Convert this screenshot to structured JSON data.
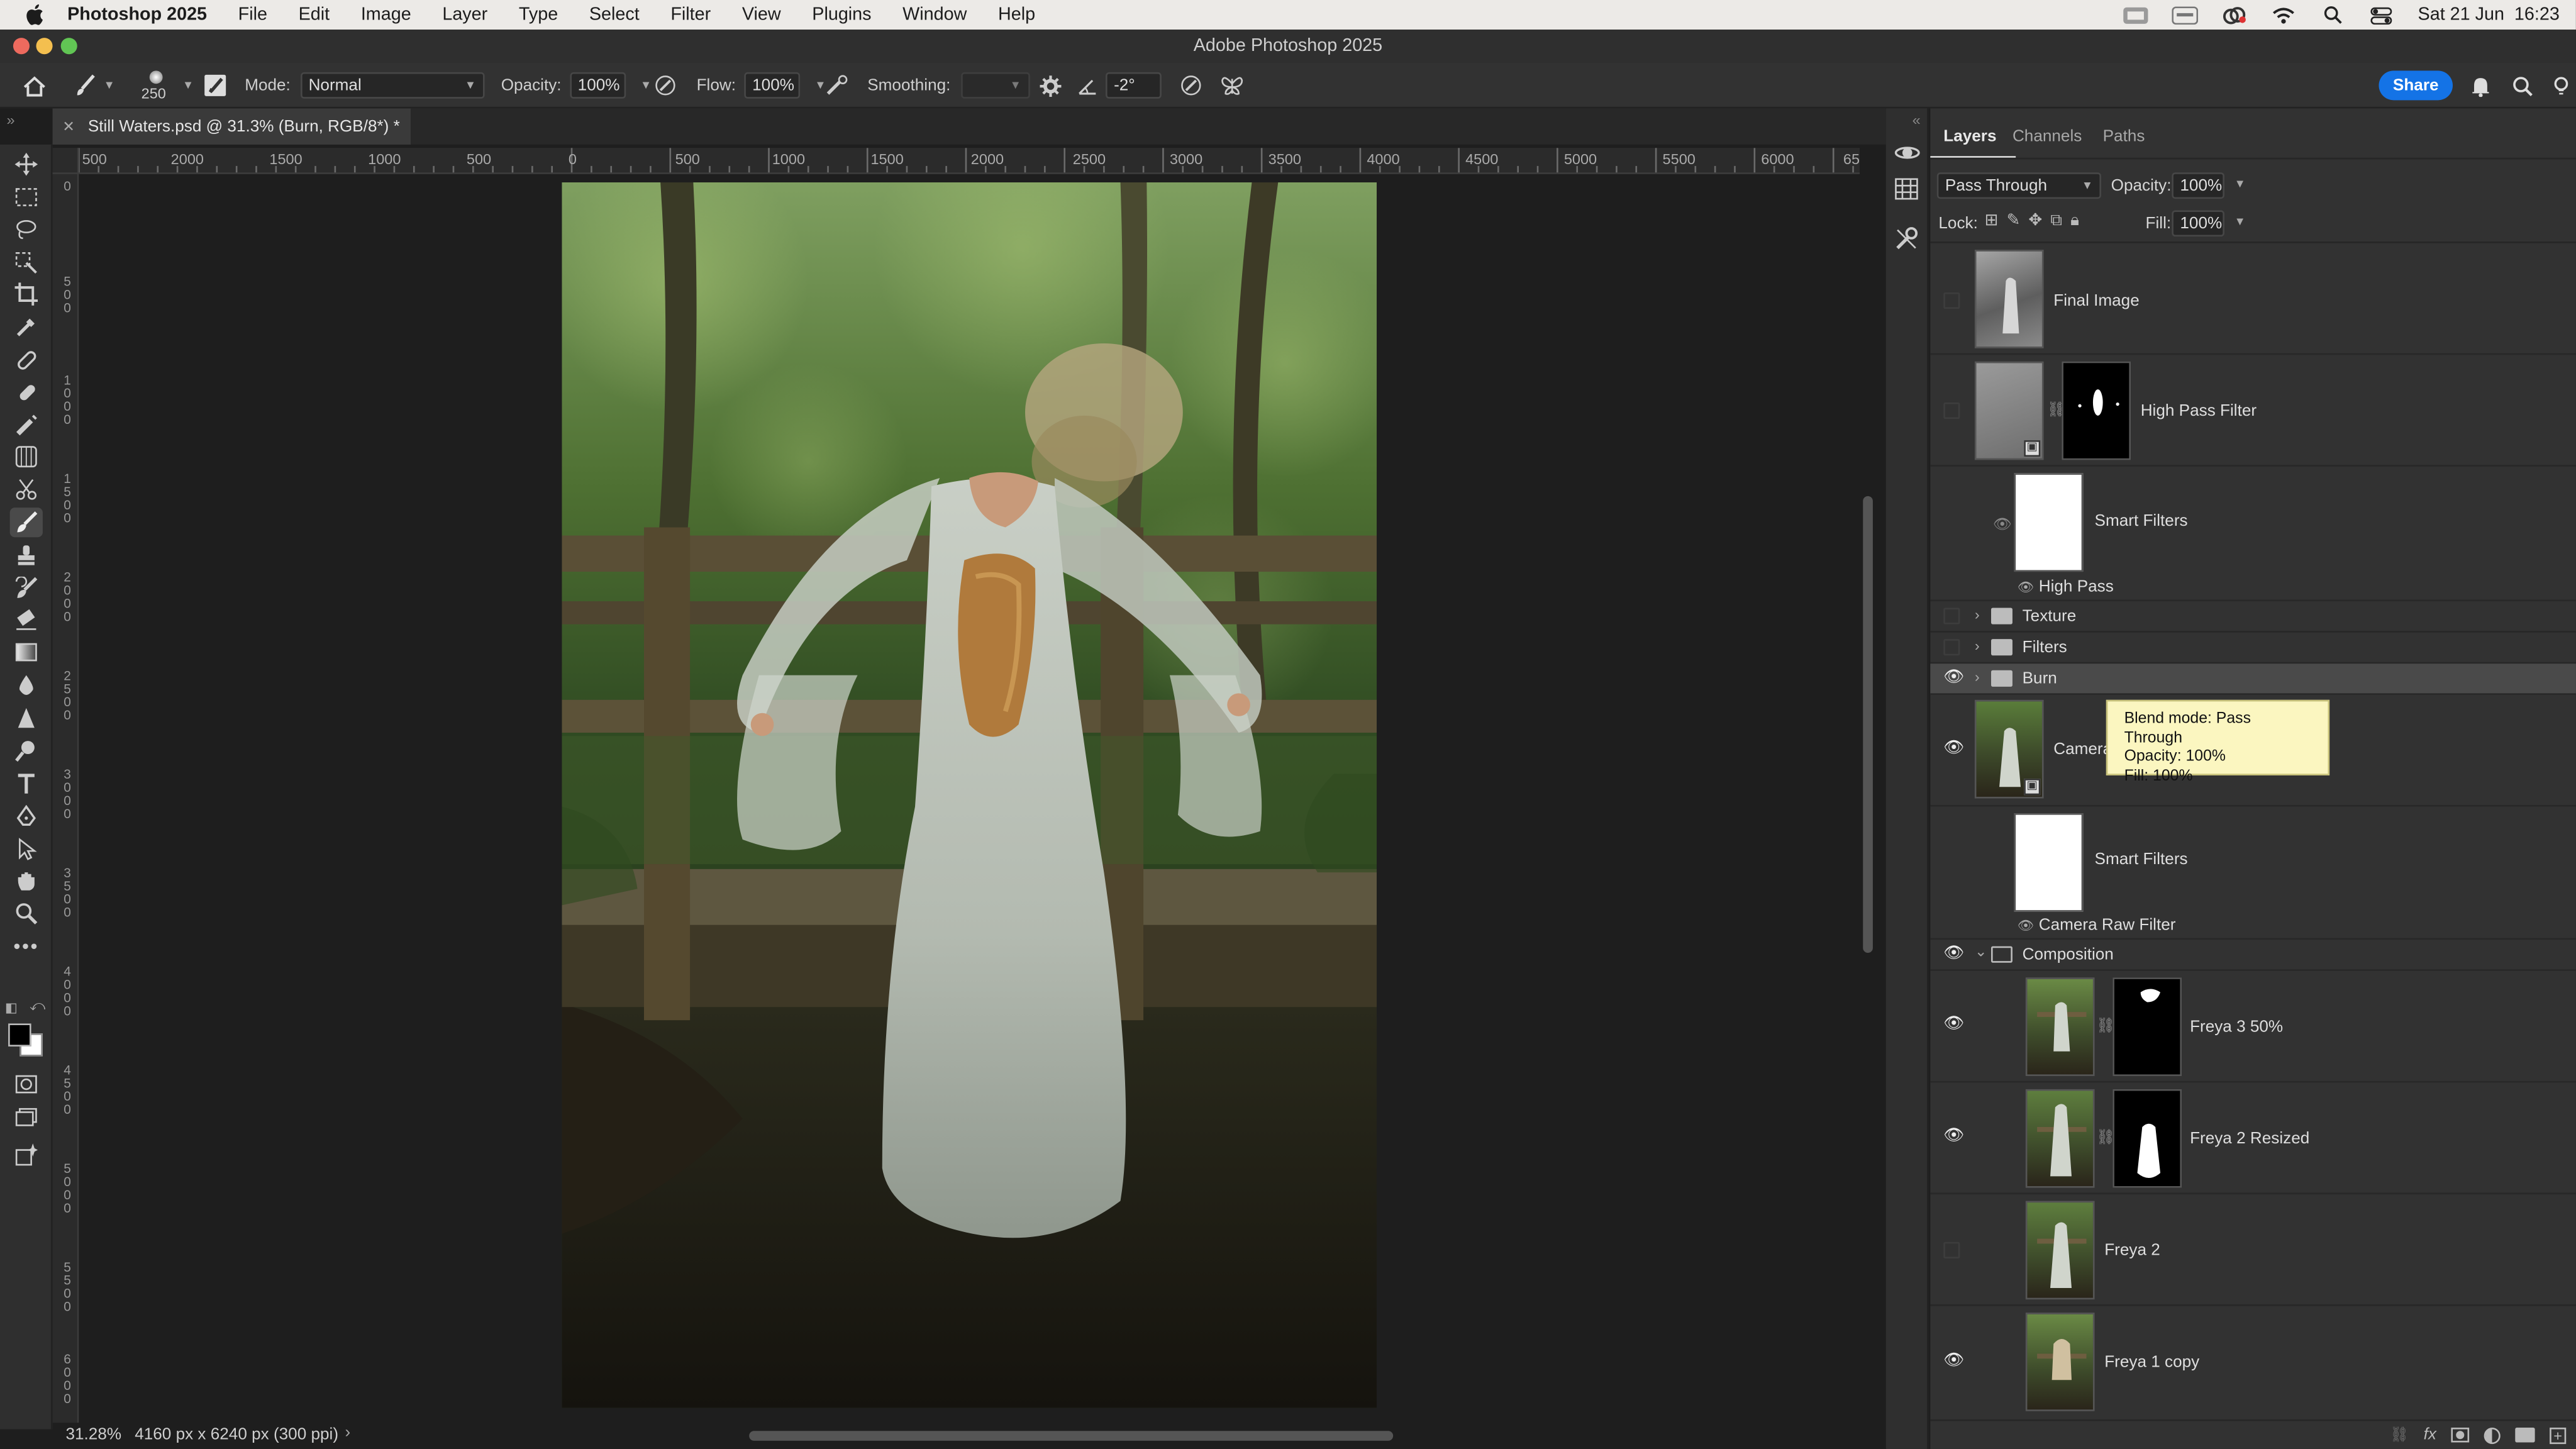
{
  "menubar": {
    "app": "Photoshop 2025",
    "items": [
      "File",
      "Edit",
      "Image",
      "Layer",
      "Type",
      "Select",
      "Filter",
      "View",
      "Plugins",
      "Window",
      "Help"
    ],
    "clock": "Sat 21 Jun  16:23"
  },
  "window": {
    "title": "Adobe Photoshop 2025"
  },
  "options": {
    "brush_size": "250",
    "mode_label": "Mode:",
    "mode_value": "Normal",
    "opacity_label": "Opacity:",
    "opacity_value": "100%",
    "flow_label": "Flow:",
    "flow_value": "100%",
    "smoothing_label": "Smoothing:",
    "smoothing_value": "",
    "angle_value": "-2°",
    "share_label": "Share"
  },
  "document": {
    "tab_title": "Still Waters.psd @ 31.3% (Burn, RGB/8*) *",
    "zoom": "31.28%",
    "info": "4160 px x 6240 px (300 ppi)"
  },
  "ruler_h": [
    "500",
    "2000",
    "1500",
    "1000",
    "500",
    "0",
    "500",
    "1000",
    "1500",
    "2000",
    "2500",
    "3000",
    "3500",
    "4000",
    "4500",
    "5000",
    "5500",
    "6000",
    "65"
  ],
  "ruler_v": [
    "0",
    "500",
    "1000",
    "1500",
    "2000",
    "2500",
    "3000",
    "3500",
    "4000",
    "4500",
    "5000",
    "5500",
    "6000"
  ],
  "panel": {
    "tabs": [
      "Layers",
      "Channels",
      "Paths"
    ],
    "blend_mode": "Pass Through",
    "opacity_label": "Opacity:",
    "opacity_value": "100%",
    "lock_label": "Lock:",
    "fill_label": "Fill:",
    "fill_value": "100%"
  },
  "layers": {
    "final_image": "Final Image",
    "high_pass_filter": "High Pass Filter",
    "smart_filters_1": "Smart Filters",
    "high_pass": "High Pass",
    "texture": "Texture",
    "filters": "Filters",
    "burn": "Burn",
    "camera": "Camera",
    "smart_filters_2": "Smart Filters",
    "camera_raw_filter": "Camera Raw Filter",
    "composition": "Composition",
    "freya3": "Freya 3 50%",
    "freya2_resized": "Freya 2 Resized",
    "freya2": "Freya 2",
    "freya1_copy": "Freya 1 copy"
  },
  "tooltip": {
    "line1": "Blend mode: Pass Through",
    "line2": "Opacity: 100%",
    "line3": "Fill: 100%"
  }
}
